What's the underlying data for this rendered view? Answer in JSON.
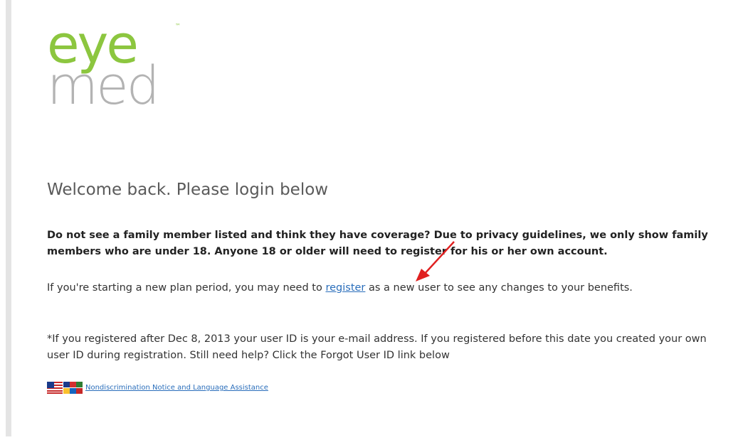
{
  "brand": {
    "logo_top": "eye",
    "logo_bottom": "med",
    "logo_mark": "™",
    "colors": {
      "green": "#8cc63f",
      "gray": "#b3b3b3",
      "link": "#2a6ebb",
      "arrow": "#e02020"
    }
  },
  "welcome_heading": "Welcome back. Please login below",
  "family_notice": "Do not see a family member listed and think they have coverage?  Due to privacy guidelines, we only show family members who are under 18.  Anyone 18 or older will need to register for his or her own account.",
  "register_para": {
    "before": "If you're starting a new plan period, you may need to ",
    "link": "register",
    "after": " as a new user to see any changes to your benefits."
  },
  "userid_para": "*If you registered after Dec 8, 2013 your user ID is your e-mail address. If you registered before this date you created your own user ID during registration. Still need help? Click the Forgot User ID link below",
  "nondiscrimination_link": "Nondiscrimination Notice and Language Assistance",
  "icons": {
    "flags": "language-flags-icon",
    "arrow": "annotation-arrow-icon"
  }
}
